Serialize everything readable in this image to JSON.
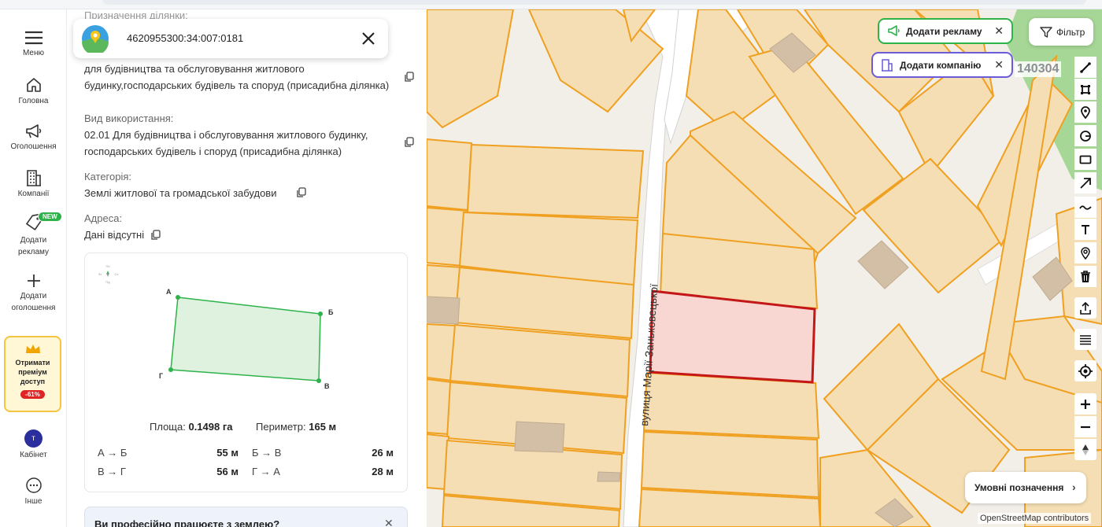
{
  "sidebar": {
    "items": [
      {
        "label": "Меню",
        "icon": "menu-icon"
      },
      {
        "label": "Головна",
        "icon": "home-icon"
      },
      {
        "label": "Оголошення",
        "icon": "megaphone-icon"
      },
      {
        "label": "Компанії",
        "icon": "building-icon"
      },
      {
        "label": "Додати рекламу",
        "icon": "tag-icon",
        "badge": "NEW"
      },
      {
        "label": "Додати оголошення",
        "icon": "plus-icon"
      },
      {
        "label": "Кабінет",
        "icon": "avatar",
        "avatar_letter": "т"
      },
      {
        "label": "Інше",
        "icon": "more-icon"
      }
    ],
    "premium": {
      "text": "Отримати преміум доступ",
      "discount": "-61%"
    }
  },
  "panel": {
    "search": {
      "value": "4620955300:34:007:0181"
    },
    "truncated_top": "Призначення ділянки:",
    "purpose_text": "для будівництва та обслуговування житлового будинку,господарських будівель та споруд (присадибна ділянка)",
    "usage_label": "Вид використання:",
    "usage_value": "02.01 Для будівництва і обслуговування житлового будинку, господарських будівель і споруд (присадибна ділянка)",
    "category_label": "Категорія:",
    "category_value": "Землі житлової та громадської забудови",
    "address_label": "Адреса:",
    "address_value": "Дані відсутні",
    "plot": {
      "vertices": [
        "А",
        "Б",
        "В",
        "Г"
      ],
      "compass": [
        "Пн",
        "Зх",
        "Сх",
        "Пд"
      ],
      "area_label": "Площа:",
      "area_value": "0.1498 га",
      "perimeter_label": "Периметр:",
      "perimeter_value": "165 м",
      "edges": [
        {
          "name": "А → Б",
          "value": "55 м"
        },
        {
          "name": "Б → В",
          "value": "26 м"
        },
        {
          "name": "В → Г",
          "value": "56 м"
        },
        {
          "name": "Г → А",
          "value": "28 м"
        }
      ]
    },
    "promo": {
      "title": "Ви професійно працюєте з землею?"
    }
  },
  "map": {
    "buttons": {
      "add_ad": "Додати рекламу",
      "add_company": "Додати компанію",
      "filter": "Фільтр"
    },
    "parcel_number": "140304",
    "street_label": "вулиця Марії Заньковецької",
    "legend": "Умовні позначення",
    "attribution": "OpenStreetMap contributors",
    "colors": {
      "parcel_fill": "#f5deb3",
      "parcel_stroke": "#f0a020",
      "selected_fill": "#f8d6d2",
      "selected_stroke": "#c41818",
      "greenbelt": "#a6d796"
    }
  }
}
